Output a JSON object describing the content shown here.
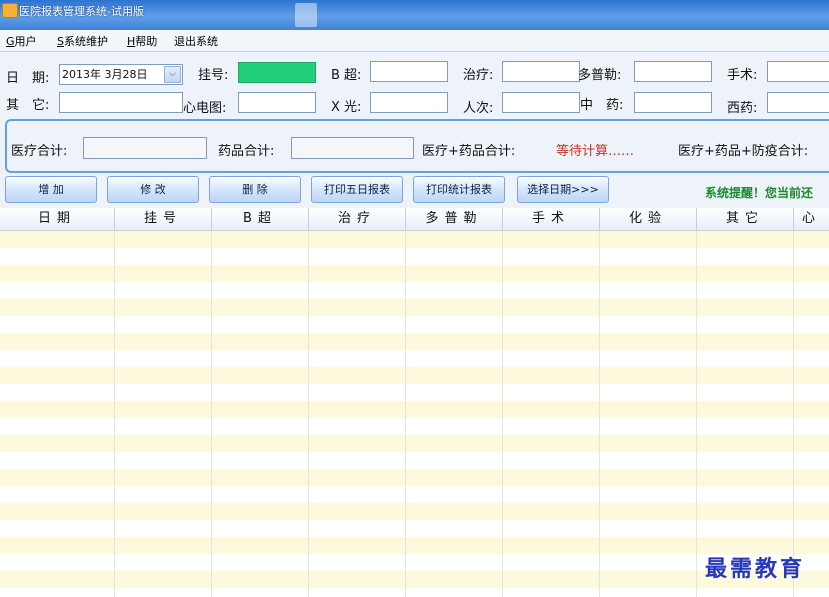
{
  "window": {
    "title": "医院报表管理系统-试用版"
  },
  "menu": {
    "items": [
      {
        "accel": "G",
        "label": "用户"
      },
      {
        "accel": "S",
        "label": "系统维护"
      },
      {
        "accel": "H",
        "label": "帮助"
      },
      {
        "accel": "",
        "label": "退出系统"
      }
    ]
  },
  "form": {
    "date_label": "日　期:",
    "date_value": "2013年  3月28日",
    "registration_label": "挂号:",
    "registration_value": "",
    "bultrasound_label": "B 超:",
    "treatment_label": "治疗:",
    "doppler_label": "多普勒:",
    "surgery_label": "手术:",
    "other_label": "其　它:",
    "ecg_label": "心电图:",
    "xray_label": "X 光:",
    "visits_label": "人次:",
    "tcm_label": "中　药:",
    "western_label": "西药:"
  },
  "totals": {
    "medical_total_label": "医疗合计:",
    "drug_total_label": "药品合计:",
    "medical_drug_label": "医疗+药品合计:",
    "status_text": "等待计算……",
    "medical_drug_epidemic_label": "医疗+药品+防疫合计:"
  },
  "toolbar": {
    "add_label": "增  加",
    "edit_label": "修  改",
    "delete_label": "删  除",
    "print5_label": "打印五日报表",
    "print_stats_label": "打印统计报表",
    "select_date_label": "选择日期>>>"
  },
  "reminder": "系统提醒！您当前还",
  "table": {
    "columns": [
      "日期",
      "挂号",
      "B超",
      "治疗",
      "多普勒",
      "手术",
      "化验",
      "其它",
      "心"
    ]
  },
  "watermark": "最需教育",
  "colors": {
    "titlebar": "#3e82d8",
    "registration_fill": "#22d07a",
    "status_red": "#c0342b",
    "reminder_green": "#1b8a2e",
    "row_yellow": "#fdf9dc"
  }
}
